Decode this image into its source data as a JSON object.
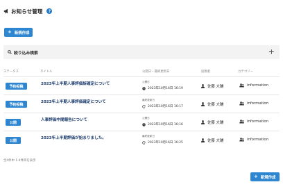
{
  "header": {
    "title": "お知らせ管理",
    "help_icon": "question-circle-icon"
  },
  "buttons": {
    "new_label": "新規作成"
  },
  "filter": {
    "label": "絞り込み検索"
  },
  "table": {
    "columns": [
      "ステータス",
      "タイトル",
      "公開日・最終更新日",
      "投稿者",
      "カテゴリー"
    ],
    "rows": [
      {
        "status": "予約投稿",
        "title": "2023年上半期人事評価訴確定について",
        "date_label": "公開日",
        "date": "2023年10月16日 16:19",
        "date_icon": "clock-icon",
        "author": "佐藤 大輔",
        "category": "information"
      },
      {
        "status": "予約投稿",
        "title": "2023年上半期人事評価確定について",
        "date_label": "最終更新日",
        "date": "2023年10月16日 16:17",
        "date_icon": "refresh-icon",
        "author": "佐藤 大輔",
        "category": "information"
      },
      {
        "status": "公開",
        "title": "人事評価中間報告について",
        "date_label": "公開日",
        "date": "2023年10月16日 16:16",
        "date_icon": "clock-icon",
        "author": "佐藤 大輔",
        "category": "information"
      },
      {
        "status": "公開",
        "title": "2023年上半期評価が始まりました。",
        "date_label": "最終更新日",
        "date": "2023年10月16日 16:25",
        "date_icon": "refresh-icon",
        "author": "佐藤 大輔",
        "category": "information"
      }
    ]
  },
  "pagination": {
    "summary": "全4件中 1-4件目を表示"
  },
  "colors": {
    "primary": "#2e86d1",
    "title_text": "#1d3c6e",
    "filter_bg": "#f3f3f3"
  }
}
